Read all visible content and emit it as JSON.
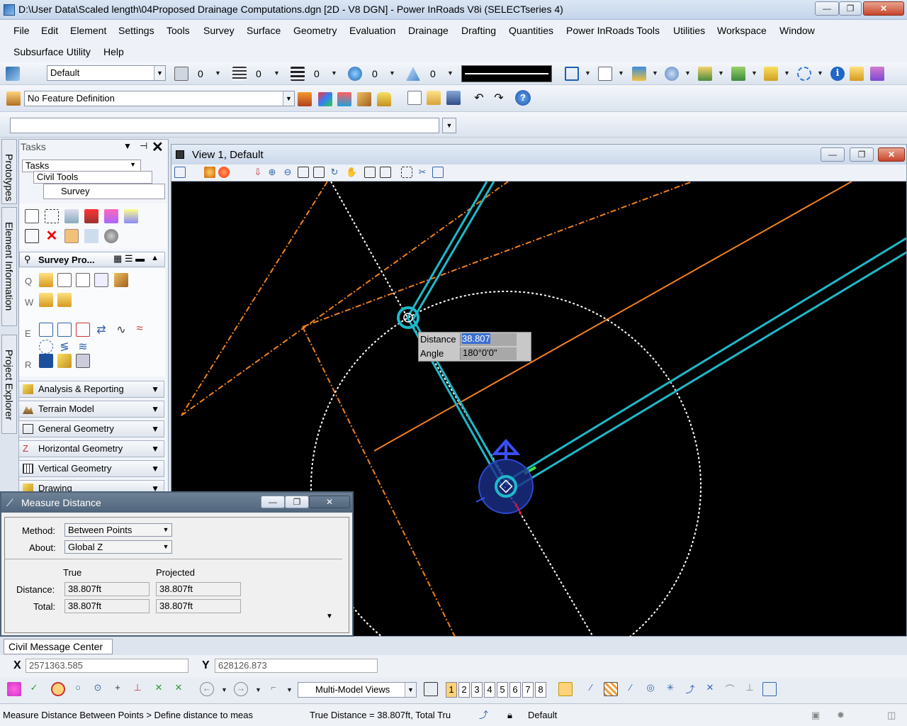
{
  "window": {
    "title": "D:\\User Data\\Scaled length\\04Proposed Drainage Computations.dgn [2D - V8 DGN] - Power InRoads V8i (SELECTseries 4)",
    "minimize": "—",
    "maximize": "❐",
    "close": "✕"
  },
  "menu": {
    "row1": [
      "File",
      "Edit",
      "Element",
      "Settings",
      "Tools",
      "Survey",
      "Surface",
      "Geometry",
      "Evaluation",
      "Drainage",
      "Drafting",
      "Quantities",
      "Power InRoads Tools",
      "Utilities",
      "Workspace",
      "Window"
    ],
    "row2": [
      "Subsurface Utility",
      "Help"
    ]
  },
  "attributes": {
    "level": "Default",
    "color": "0",
    "style": "0",
    "weight": "0",
    "transparency": "0",
    "priority": "0"
  },
  "feature": {
    "definition": "No Feature Definition"
  },
  "command_input": {
    "value": ""
  },
  "side_tabs": [
    "Prototypes",
    "Element Information",
    "Project Explorer"
  ],
  "tasks": {
    "title": "Tasks",
    "breadcrumb": [
      "Tasks",
      "Civil Tools",
      "Survey"
    ],
    "survey_header": "Survey Pro...",
    "row_letters": [
      "Q",
      "W",
      "E",
      "R"
    ],
    "sections": [
      "Analysis & Reporting",
      "Terrain Model",
      "General Geometry",
      "Horizontal Geometry",
      "Vertical Geometry",
      "Drawing"
    ]
  },
  "view": {
    "title": "View 1, Default",
    "tooltip": {
      "distance_label": "Distance",
      "distance_value": "38.807",
      "angle_label": "Angle",
      "angle_value": "180°0'0\""
    }
  },
  "measure_dialog": {
    "title": "Measure Distance",
    "method_label": "Method:",
    "method_value": "Between Points",
    "about_label": "About:",
    "about_value": "Global Z",
    "col_true": "True",
    "col_projected": "Projected",
    "distance_label": "Distance:",
    "total_label": "Total:",
    "distance_true": "38.807ft",
    "distance_projected": "38.807ft",
    "total_true": "38.807ft",
    "total_projected": "38.807ft"
  },
  "message_center": {
    "tab": "Civil Message Center"
  },
  "coords": {
    "x_label": "X",
    "x_value": "2571363.585",
    "y_label": "Y",
    "y_value": "628126.873"
  },
  "views_group": {
    "value": "Multi-Model Views",
    "buttons": [
      "1",
      "2",
      "3",
      "4",
      "5",
      "6",
      "7",
      "8"
    ]
  },
  "status": {
    "prompt": "Measure Distance Between Points > Define distance to meas",
    "message": "True Distance = 38.807ft, Total Tru",
    "level": "Default"
  },
  "colors": {
    "cyan": "#1fb8c8",
    "orange": "#f08020",
    "background": "#000000"
  }
}
